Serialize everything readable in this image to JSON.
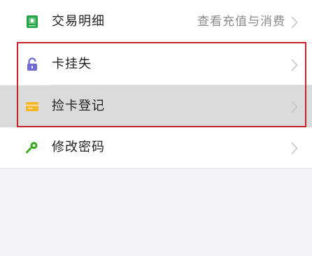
{
  "menu": {
    "items": [
      {
        "label": "交易明细",
        "detail": "查看充值与消费",
        "icon": "wallet-icon"
      },
      {
        "label": "卡挂失",
        "icon": "lock-icon"
      },
      {
        "label": "捡卡登记",
        "icon": "card-icon"
      },
      {
        "label": "修改密码",
        "icon": "key-icon"
      }
    ]
  },
  "colors": {
    "accent_green": "#22a447",
    "lock_purple": "#6f6bd6",
    "card_yellow": "#f5b623",
    "highlight_red": "#c8232a"
  }
}
